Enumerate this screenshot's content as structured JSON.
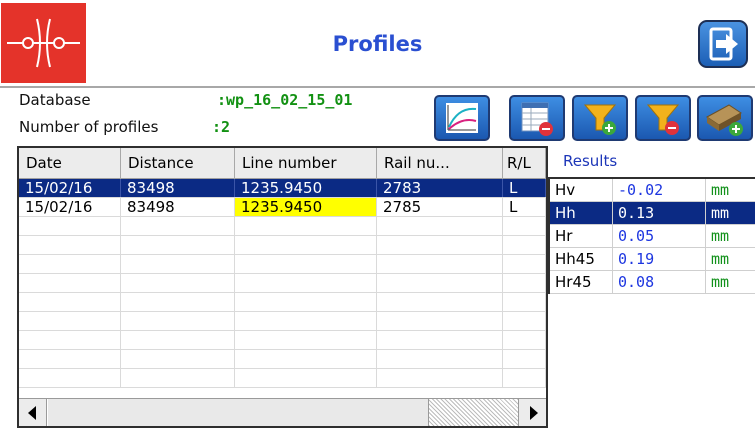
{
  "header": {
    "title": "Profiles",
    "exit_icon": "exit-icon",
    "logo_icon": "logo-icon"
  },
  "info": {
    "database_label": "Database",
    "database_value": ":wp_16_02_15_01",
    "profiles_label": "Number of profiles",
    "profiles_value": ":2"
  },
  "toolbar": [
    {
      "icon": "chart-icon"
    },
    {
      "icon": "delete-table-icon"
    },
    {
      "icon": "filter-add-icon"
    },
    {
      "icon": "filter-remove-icon"
    },
    {
      "icon": "rail-add-icon"
    }
  ],
  "table": {
    "columns": [
      "Date",
      "Distance",
      "Line number",
      "Rail nu...",
      "R/L"
    ],
    "rows": [
      {
        "date": "15/02/16",
        "distance": "83498",
        "line": "1235.9450",
        "rail": "2783",
        "rl": "L"
      },
      {
        "date": "15/02/16",
        "distance": "83498",
        "line": "1235.9450",
        "rail": "2785",
        "rl": "L"
      }
    ],
    "selected_row": 0,
    "highlight_color": "#ffff00",
    "selection_color": "#0b2a84"
  },
  "results": {
    "title": "Results",
    "rows": [
      {
        "name": "Hv",
        "value": "-0.02",
        "unit": "mm"
      },
      {
        "name": "Hh",
        "value": "0.13",
        "unit": "mm"
      },
      {
        "name": "Hr",
        "value": "0.05",
        "unit": "mm"
      },
      {
        "name": "Hh45",
        "value": "0.19",
        "unit": "mm"
      },
      {
        "name": "Hr45",
        "value": "0.08",
        "unit": "mm"
      }
    ],
    "selected_row": 1
  }
}
